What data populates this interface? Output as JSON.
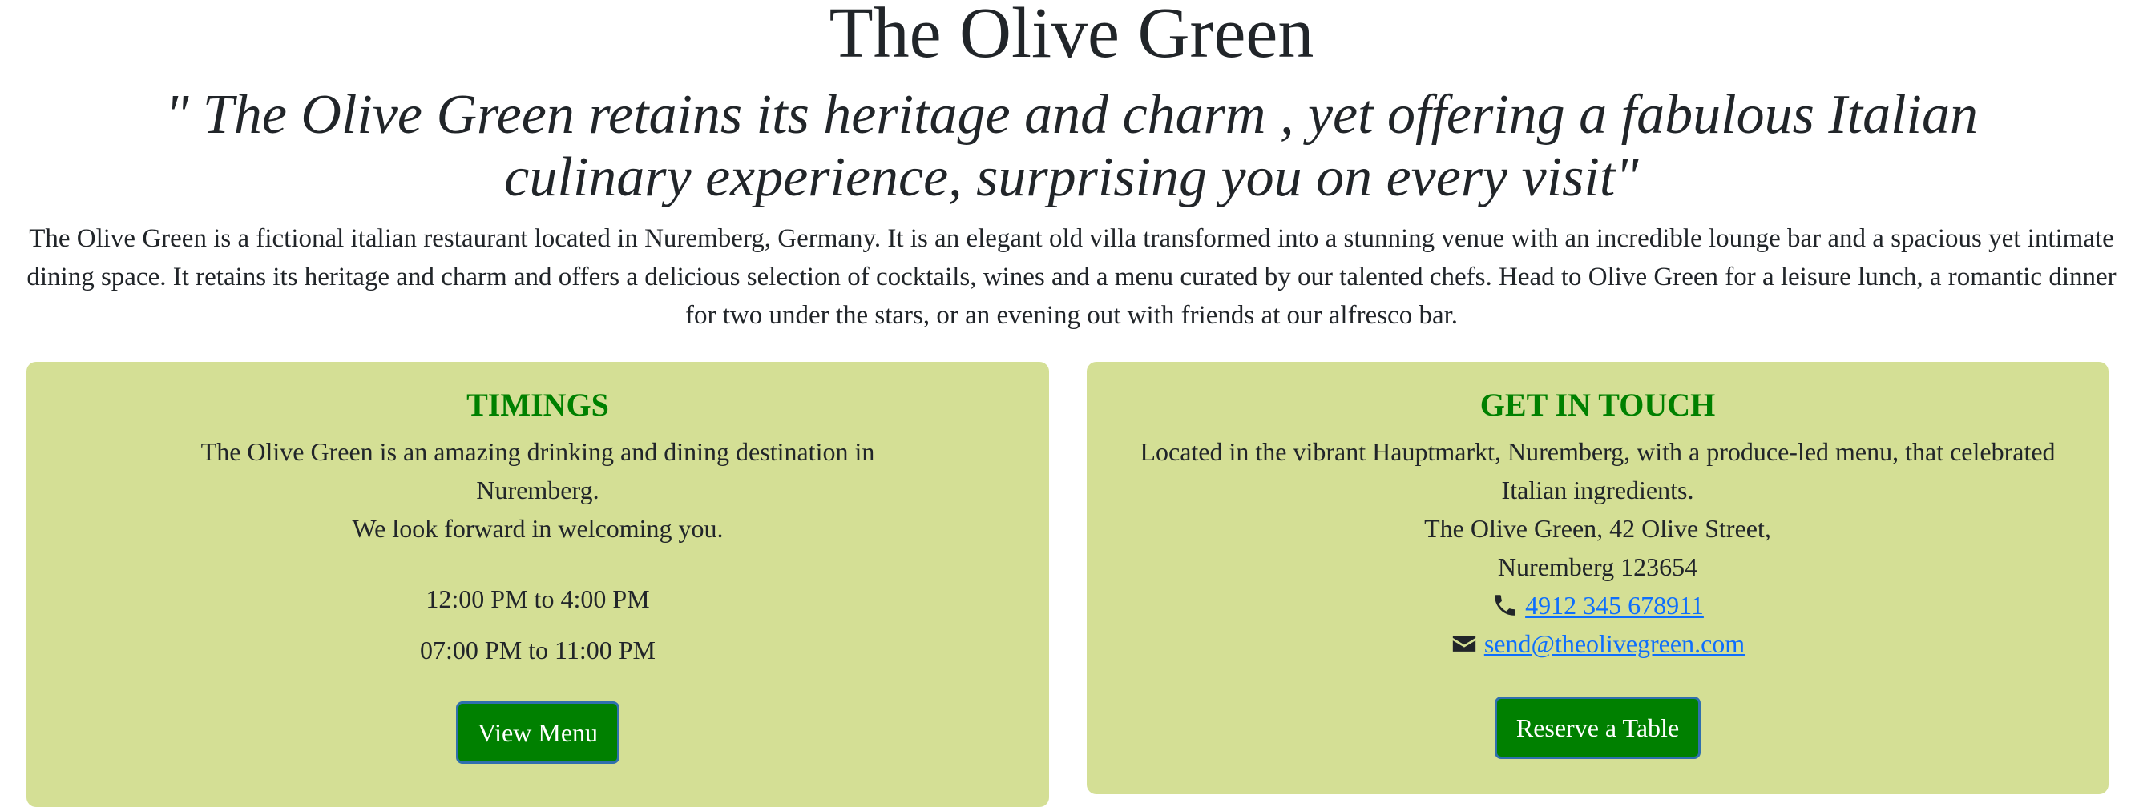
{
  "header": {
    "title": "The Olive Green",
    "tagline": "\" The Olive Green retains its heritage and charm , yet offering a fabulous Italian culinary experience, surprising you on every visit\"",
    "intro": "The Olive Green is a fictional italian restaurant located in Nuremberg, Germany. It is an elegant old villa transformed into a stunning venue with an incredible lounge bar and a spacious yet intimate dining space. It retains its heritage and charm and offers a delicious selection of cocktails, wines and a menu curated by our talented chefs. Head to Olive Green for a leisure lunch, a romantic dinner for two under the stars, or an evening out with friends at our alfresco bar."
  },
  "timings": {
    "heading": "TIMINGS",
    "line1": "The Olive Green is an amazing drinking and dining destination in Nuremberg.",
    "line2": "We look forward in welcoming you.",
    "hours": [
      "12:00 PM to 4:00 PM",
      "07:00 PM to 11:00 PM"
    ],
    "button_label": "View Menu"
  },
  "contact": {
    "heading": "GET IN TOUCH",
    "description": "Located in the vibrant Hauptmarkt, Nuremberg, with a produce-led menu, that celebrated Italian ingredients.",
    "address_line1": "The Olive Green, 42 Olive Street,",
    "address_line2": "Nuremberg 123654",
    "phone": "4912 345 678911",
    "email": "send@theolivegreen.com",
    "button_label": "Reserve a Table",
    "icons": {
      "phone": "phone-icon",
      "email": "envelope-icon"
    }
  },
  "colors": {
    "card_background": "#d4df95",
    "heading_green": "#008000",
    "button_green": "#008000",
    "link_blue": "#0d6efd",
    "text": "#212529"
  }
}
